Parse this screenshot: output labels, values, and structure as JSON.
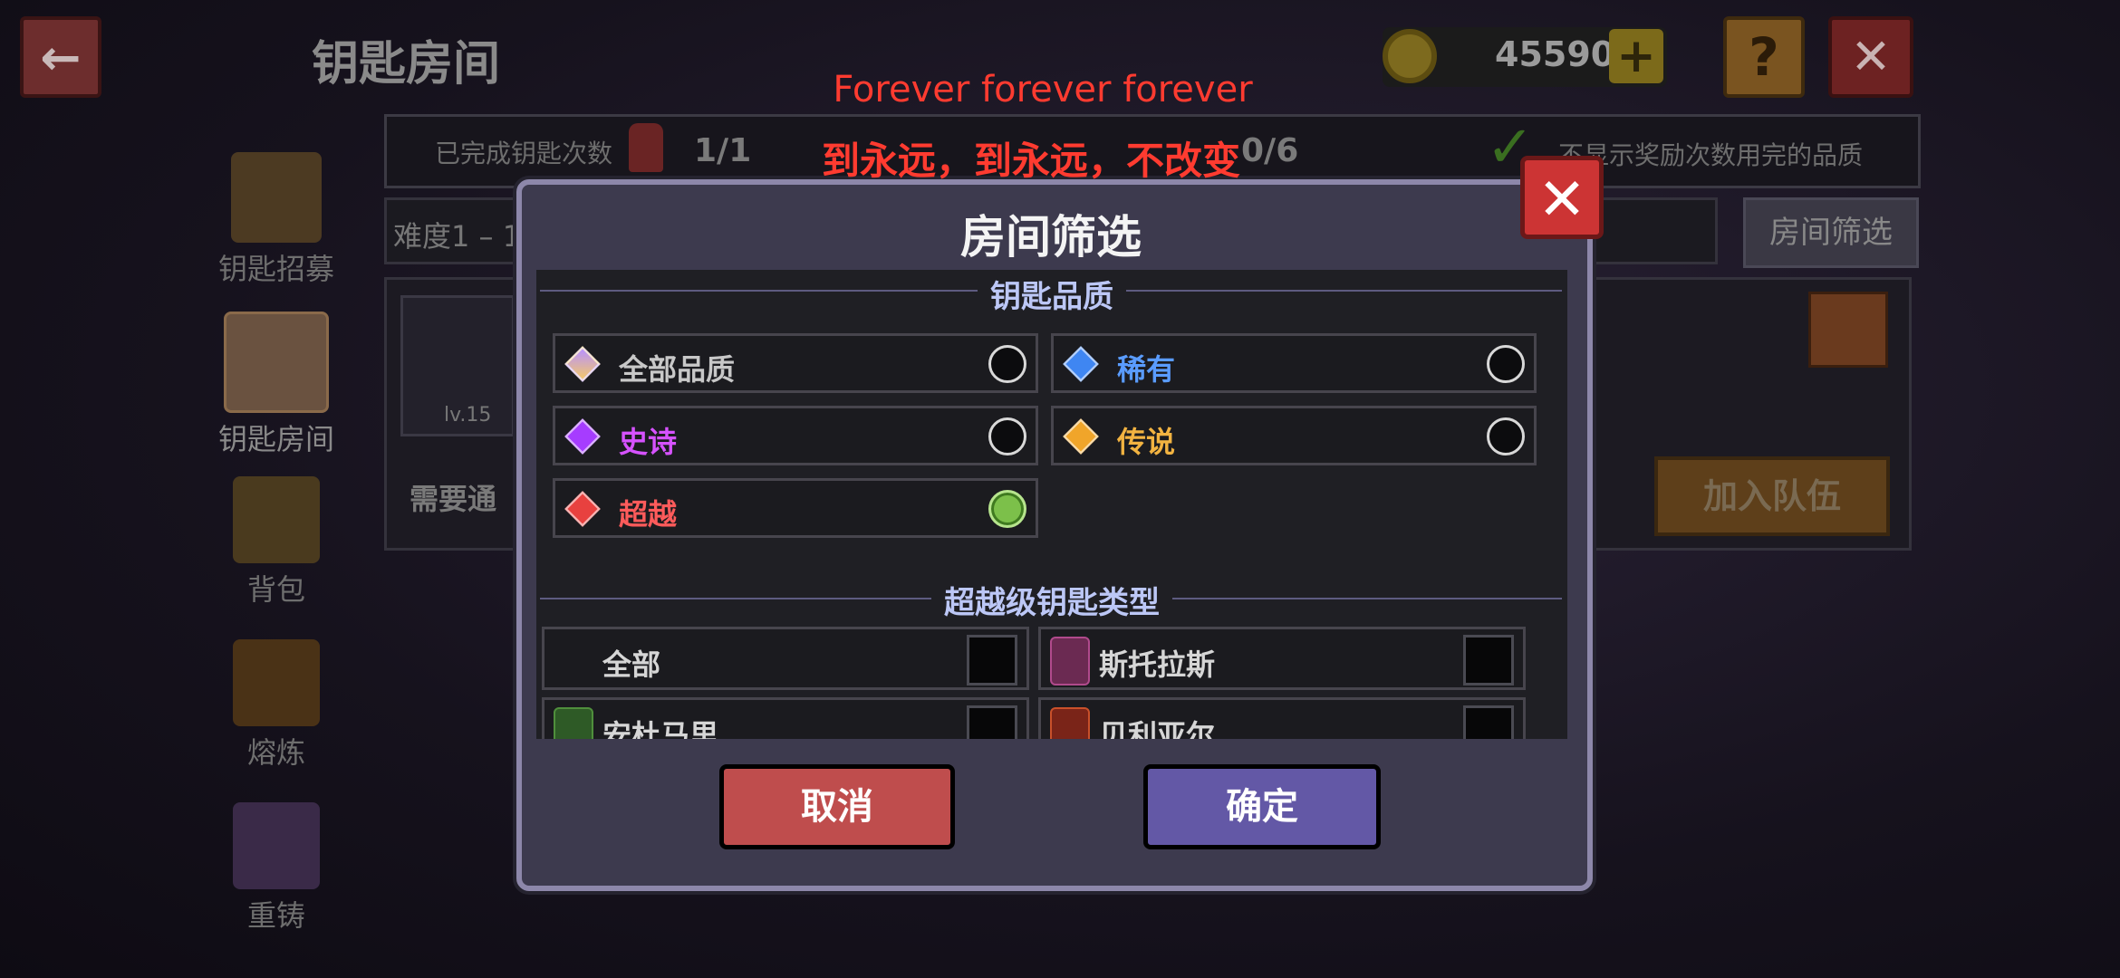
{
  "header": {
    "title": "钥匙房间",
    "coins": "45590"
  },
  "stats": {
    "completed_label": "已完成钥匙次数",
    "values": [
      "1/1",
      "0/6"
    ],
    "hide_label": "不显示奖励次数用完的品质"
  },
  "difficulty": {
    "text": "难度1 – 1"
  },
  "filter_button": "房间筛选",
  "sidebar": {
    "items": [
      {
        "label": "钥匙招募"
      },
      {
        "label": "钥匙房间"
      },
      {
        "label": "背包"
      },
      {
        "label": "熔炼"
      },
      {
        "label": "重铸"
      }
    ]
  },
  "room": {
    "level": "lv.15",
    "need_text": "需要通",
    "join_label": "加入队伍"
  },
  "subtitles": {
    "line1": "Forever forever forever",
    "line2": "到永远，到永远，不改变"
  },
  "modal": {
    "title": "房间筛选",
    "quality_section": "钥匙品质",
    "qualities": [
      {
        "label": "全部品质",
        "color": "#c8c8c8",
        "gem": "#c9a0ff",
        "selected": false
      },
      {
        "label": "稀有",
        "color": "#5a9cff",
        "gem": "#3f86f2",
        "selected": false
      },
      {
        "label": "史诗",
        "color": "#d652ff",
        "gem": "#a63cff",
        "selected": false
      },
      {
        "label": "传说",
        "color": "#f2b341",
        "gem": "#f0a52a",
        "selected": false
      },
      {
        "label": "超越",
        "color": "#ff5b5b",
        "gem": "#e8413f",
        "selected": true
      }
    ],
    "type_section": "超越级钥匙类型",
    "key_types": [
      {
        "label": "全部"
      },
      {
        "label": "斯托拉斯",
        "icon": "#b04a8c"
      },
      {
        "label": "安杜马里",
        "icon": "#4f8f3c"
      },
      {
        "label": "贝利亚尔",
        "icon": "#c8502a"
      }
    ],
    "cancel_label": "取消",
    "ok_label": "确定"
  }
}
